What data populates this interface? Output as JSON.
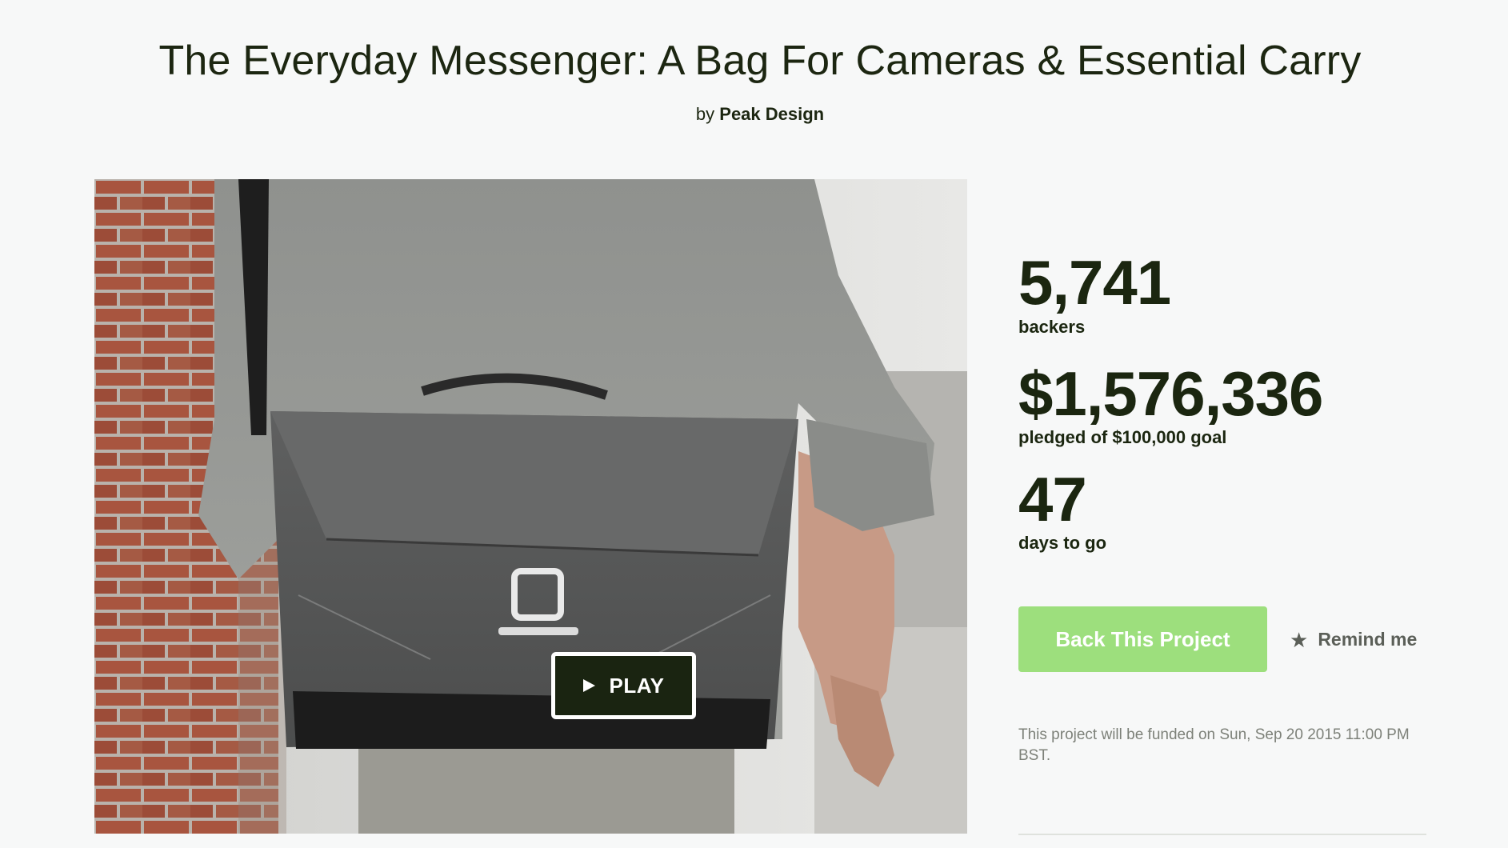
{
  "project": {
    "title": "The Everyday Messenger: A Bag For Cameras & Essential Carry",
    "by_prefix": "by",
    "creator": "Peak Design"
  },
  "media": {
    "play_label": "PLAY",
    "play_icon": "play-triangle-icon"
  },
  "stats": {
    "backers_count": "5,741",
    "backers_label": "backers",
    "pledged_amount": "$1,576,336",
    "pledged_label": "pledged of $100,000 goal",
    "days_count": "47",
    "days_label": "days to go"
  },
  "actions": {
    "back_label": "Back This Project",
    "remind_label": "Remind me",
    "remind_icon": "star-icon"
  },
  "funding_note": "This project will be funded on Sun, Sep 20 2015 11:00 PM BST.",
  "colors": {
    "background": "#f7f8f8",
    "text": "#1b2610",
    "accent_green": "#9ddf7d",
    "play_bg": "#1a2411",
    "muted": "#7d8179"
  }
}
